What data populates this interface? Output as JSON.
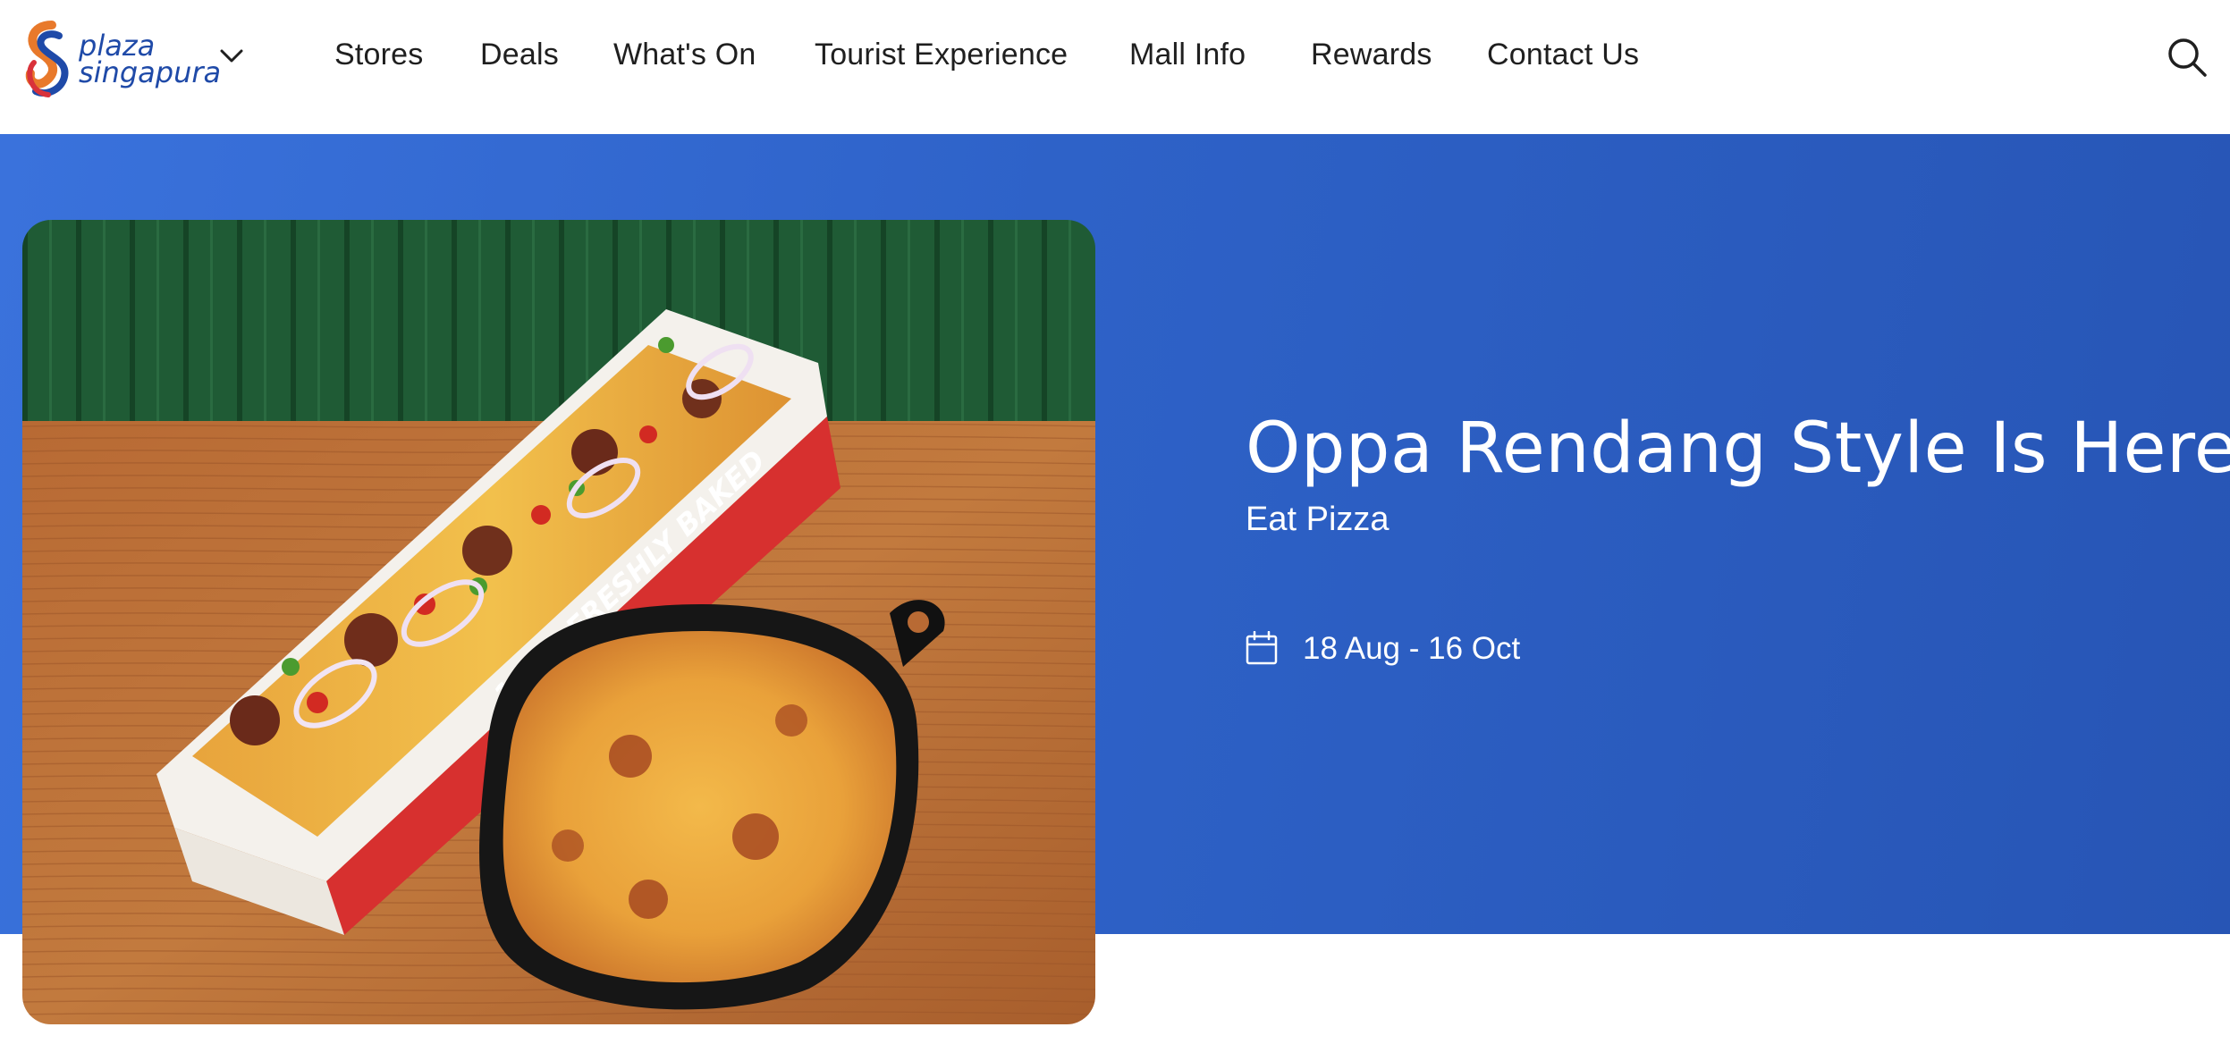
{
  "brand": {
    "name_line1": "plaza",
    "name_line2": "singapura",
    "logo_icon": "plaza-singapura-logo",
    "colors": {
      "orange": "#e8792b",
      "blue": "#1f4aa8",
      "red": "#d9323a"
    }
  },
  "nav": {
    "items": [
      {
        "label": "Stores"
      },
      {
        "label": "Deals"
      },
      {
        "label": "What's On"
      },
      {
        "label": "Tourist Experience"
      },
      {
        "label": "Mall Info"
      },
      {
        "label": "Rewards"
      },
      {
        "label": "Contact Us"
      }
    ],
    "dropdown_icon": "chevron-down-icon",
    "search_icon": "search-icon"
  },
  "hero": {
    "title": "Oppa Rendang Style Is Here",
    "subtitle": "Eat Pizza",
    "date_range": "18 Aug - 16 Oct",
    "date_icon": "calendar-icon",
    "image": {
      "description_icon": "promo-food-image",
      "box_text": "100% FRESHLY BAKED"
    },
    "colors": {
      "background": "#2e62c8",
      "text": "#ffffff"
    }
  }
}
